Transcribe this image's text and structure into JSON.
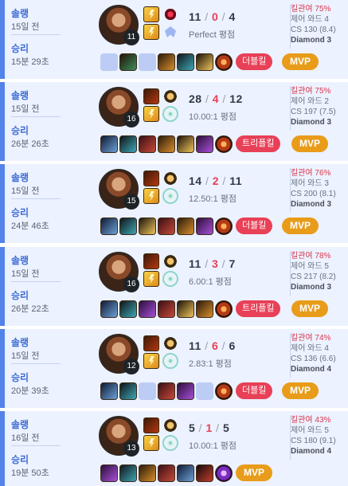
{
  "matches": [
    {
      "queue": "솔랭",
      "ago": "15일 전",
      "result": "승리",
      "duration": "15분 29초",
      "level": "11",
      "spells": [
        "flash",
        "flash"
      ],
      "runes": [
        "electrocute",
        "inspiration"
      ],
      "kills": "11",
      "deaths": "0",
      "assists": "4",
      "ratio": "Perfect 평점",
      "kp": "킬관여 75%",
      "wards": "제어 와드 4",
      "cs": "CS 130 (8.4)",
      "tier": "Diamond 3",
      "items": [
        "empty",
        "c1",
        "empty",
        "c3",
        "c5",
        "c6",
        "ward"
      ],
      "multikill": "더블킬",
      "mvp": "MVP"
    },
    {
      "queue": "솔랭",
      "ago": "15일 전",
      "result": "승리",
      "duration": "26분 26초",
      "level": "16",
      "spells": [
        "ignite",
        "flash"
      ],
      "runes": [
        "conqueror",
        "resolve"
      ],
      "kills": "28",
      "deaths": "4",
      "assists": "12",
      "ratio": "10.00:1 평점",
      "kp": "킬관여 75%",
      "wards": "제어 와드 2",
      "cs": "CS 197 (7.5)",
      "tier": "Diamond 3",
      "items": [
        "c0",
        "c5",
        "c2",
        "c3",
        "c6",
        "c4",
        "ward"
      ],
      "multikill": "트리플킬",
      "mvp": "MVP"
    },
    {
      "queue": "솔랭",
      "ago": "15일 전",
      "result": "승리",
      "duration": "24분 46초",
      "level": "15",
      "spells": [
        "ignite",
        "flash"
      ],
      "runes": [
        "conqueror",
        "resolve"
      ],
      "kills": "14",
      "deaths": "2",
      "assists": "11",
      "ratio": "12.50:1 평점",
      "kp": "킬관여 76%",
      "wards": "제어 와드 3",
      "cs": "CS 200 (8.1)",
      "tier": "Diamond 3",
      "items": [
        "c0",
        "c5",
        "c6",
        "c2",
        "c3",
        "c4",
        "ward"
      ],
      "multikill": "더블킬",
      "mvp": "MVP"
    },
    {
      "queue": "솔랭",
      "ago": "15일 전",
      "result": "승리",
      "duration": "26분 22초",
      "level": "16",
      "spells": [
        "ignite",
        "flash"
      ],
      "runes": [
        "conqueror",
        "resolve"
      ],
      "kills": "11",
      "deaths": "3",
      "assists": "7",
      "ratio": "6.00:1 평점",
      "kp": "킬관여 78%",
      "wards": "제어 와드 5",
      "cs": "CS 217 (8.2)",
      "tier": "Diamond 3",
      "items": [
        "c0",
        "c5",
        "c4",
        "c2",
        "c6",
        "c3",
        "ward"
      ],
      "multikill": "트리플킬",
      "mvp": "MVP"
    },
    {
      "queue": "솔랭",
      "ago": "15일 전",
      "result": "승리",
      "duration": "20분 39초",
      "level": "12",
      "spells": [
        "ignite",
        "flash"
      ],
      "runes": [
        "conqueror",
        "resolve"
      ],
      "kills": "11",
      "deaths": "6",
      "assists": "6",
      "ratio": "2.83:1 평점",
      "kp": "킬관여 74%",
      "wards": "제어 와드 4",
      "cs": "CS 136 (6.6)",
      "tier": "Diamond 4",
      "items": [
        "c0",
        "c5",
        "empty",
        "c2",
        "c4",
        "empty",
        "ward"
      ],
      "multikill": "더블킬",
      "mvp": "MVP"
    },
    {
      "queue": "솔랭",
      "ago": "16일 전",
      "result": "승리",
      "duration": "19분 50초",
      "level": "13",
      "spells": [
        "ignite",
        "flash"
      ],
      "runes": [
        "conqueror",
        "resolve"
      ],
      "kills": "5",
      "deaths": "1",
      "assists": "5",
      "ratio": "10.00:1 평점",
      "kp": "킬관여 43%",
      "wards": "제어 와드 5",
      "cs": "CS 180 (9.1)",
      "tier": "Diamond 4",
      "items": [
        "c4",
        "c5",
        "c3",
        "c2",
        "c0",
        "c7",
        "wardp"
      ],
      "multikill": "",
      "mvp": "MVP"
    }
  ]
}
